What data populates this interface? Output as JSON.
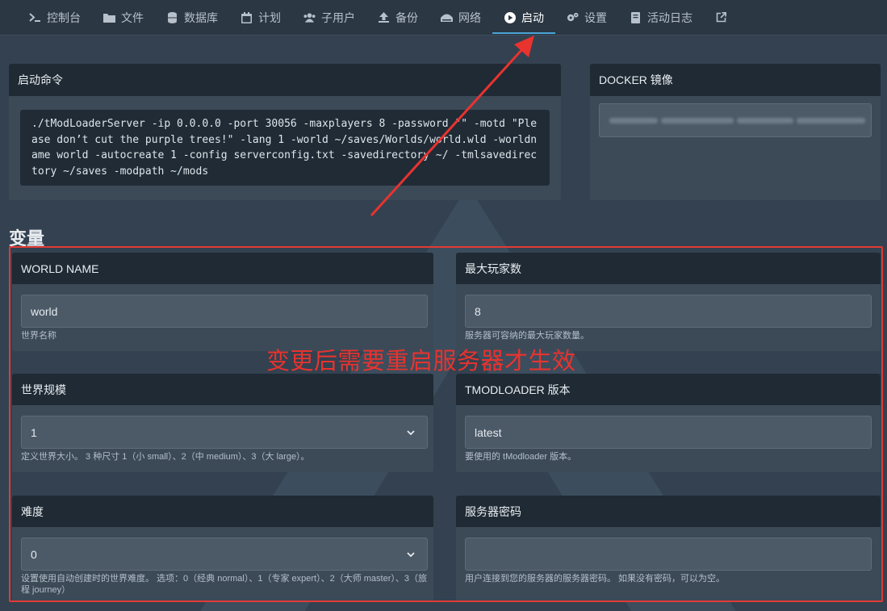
{
  "nav": {
    "items": [
      {
        "icon": "terminal-icon",
        "label": "控制台"
      },
      {
        "icon": "folder-icon",
        "label": "文件"
      },
      {
        "icon": "database-icon",
        "label": "数据库"
      },
      {
        "icon": "calendar-icon",
        "label": "计划"
      },
      {
        "icon": "users-icon",
        "label": "子用户"
      },
      {
        "icon": "upload-icon",
        "label": "备份"
      },
      {
        "icon": "network-icon",
        "label": "网络"
      },
      {
        "icon": "play-icon",
        "label": "启动",
        "active": true
      },
      {
        "icon": "gears-icon",
        "label": "设置"
      },
      {
        "icon": "book-icon",
        "label": "活动日志"
      },
      {
        "icon": "external-link-icon",
        "label": ""
      }
    ]
  },
  "startup": {
    "title": "启动命令",
    "command": "./tModLoaderServer -ip 0.0.0.0 -port 30056 -maxplayers 8 -password \"\" -motd \"Please don’t cut the purple trees!\" -lang 1 -world ~/saves/Worlds/world.wld -worldname world -autocreate 1 -config serverconfig.txt -savedirectory ~/ -tmlsavedirectory ~/saves -modpath ~/mods"
  },
  "docker": {
    "title": "DOCKER 镜像"
  },
  "variables": {
    "title": "变量",
    "world_name": {
      "label": "WORLD NAME",
      "value": "world",
      "hint": "世界名称"
    },
    "max_players": {
      "label": "最大玩家数",
      "value": "8",
      "hint": "服务器可容纳的最大玩家数量。"
    },
    "world_size": {
      "label": "世界规模",
      "value": "1",
      "hint": "定义世界大小。 3 种尺寸 1（小 small）、2（中 medium）、3（大 large）。"
    },
    "tmod_version": {
      "label": "TMODLOADER 版本",
      "value": "latest",
      "hint": "要使用的 tModloader 版本。"
    },
    "difficulty": {
      "label": "难度",
      "value": "0",
      "hint": "设置使用自动创建时的世界难度。 选项：0（经典 normal）、1（专家 expert）、2（大师 master）、3（旅程 journey）"
    },
    "server_password": {
      "label": "服务器密码",
      "value": "",
      "hint": "用户连接到您的服务器的服务器密码。 如果没有密码，可以为空。"
    }
  },
  "annotation": {
    "text": "变更后需要重启服务器才生效",
    "color": "#e8332e"
  },
  "colors": {
    "accent": "#4aa3d6",
    "annotation_red": "#e23a35"
  }
}
